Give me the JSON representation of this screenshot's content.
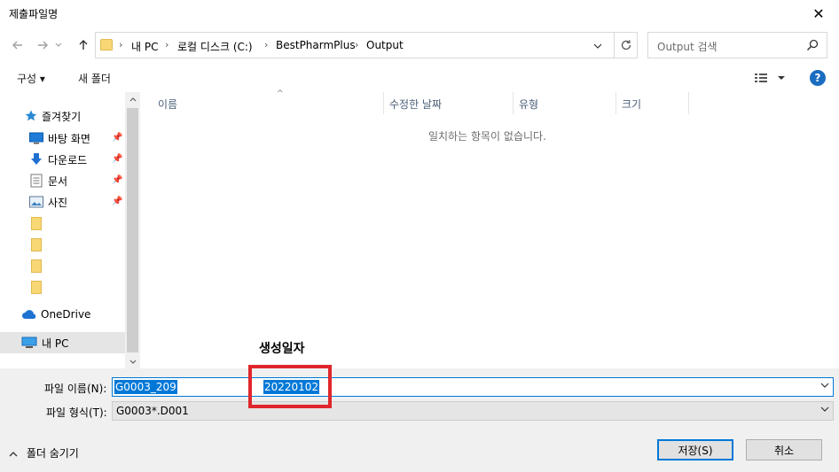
{
  "window": {
    "title": "제출파일명",
    "close_glyph": "✕"
  },
  "navigation": {
    "breadcrumb": [
      "내 PC",
      "로컬 디스크 (C:)",
      "BestPharmPlus",
      "Output"
    ],
    "search_placeholder": "Output 검색"
  },
  "toolbar": {
    "organize_label": "구성 ▾",
    "new_folder_label": "새 폴더"
  },
  "sidebar": {
    "quick_access": "즐겨찾기",
    "items": [
      {
        "label": "바탕 화면",
        "icon": "desktop-icon",
        "pinned": true
      },
      {
        "label": "다운로드",
        "icon": "download-icon",
        "pinned": true
      },
      {
        "label": "문서",
        "icon": "document-icon",
        "pinned": true
      },
      {
        "label": "사진",
        "icon": "pictures-icon",
        "pinned": true
      }
    ],
    "onedrive": "OneDrive",
    "this_pc": "내 PC"
  },
  "file_list": {
    "columns": [
      "이름",
      "수정한 날짜",
      "유형",
      "크기"
    ],
    "empty_message": "일치하는 항목이 없습니다."
  },
  "annotation": {
    "label": "생성일자"
  },
  "form": {
    "filename_label": "파일 이름(N):",
    "filename_part1": "G0003_209",
    "filename_part2": "20220102",
    "filetype_label": "파일 형식(T):",
    "filetype_value": "G0003*.D001"
  },
  "footer": {
    "hide_folders": "폴더 숨기기",
    "save_label": "저장(S)",
    "cancel_label": "취소"
  },
  "colors": {
    "accent": "#0078d7",
    "annotation_box": "#e0262c",
    "folder": "#f8d775"
  }
}
